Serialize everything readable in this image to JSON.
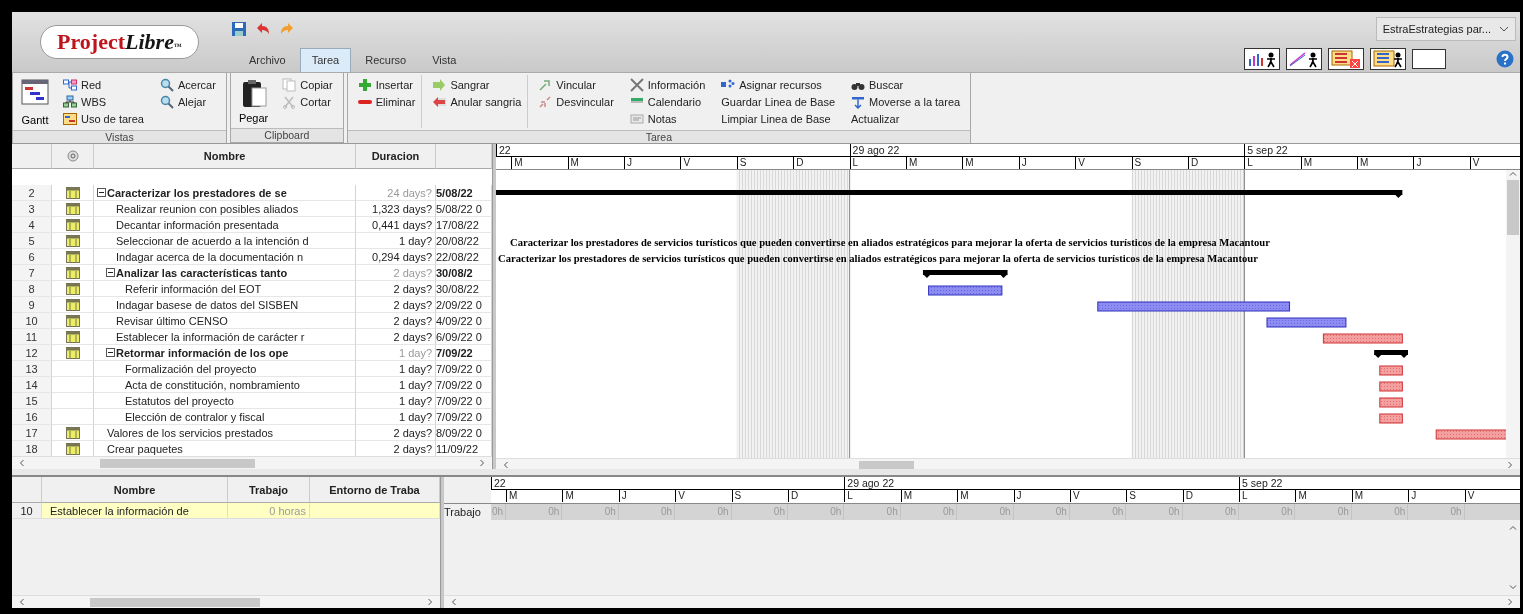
{
  "app": {
    "logo": {
      "first": "Project",
      "second": "Libre",
      "mark": "™"
    },
    "project_dropdown": "EstraEstrategias par..."
  },
  "tabs": [
    {
      "label": "Archivo",
      "selected": false
    },
    {
      "label": "Tarea",
      "selected": true
    },
    {
      "label": "Recurso",
      "selected": false
    },
    {
      "label": "Vista",
      "selected": false
    }
  ],
  "ribbon": {
    "groups": [
      {
        "label": "Vistas",
        "large": "Gantt",
        "columns": [
          [
            "Red",
            "WBS",
            "Uso de tarea"
          ],
          [
            "Acercar",
            "Alejar"
          ]
        ]
      },
      {
        "label": "Clipboard",
        "large": "Pegar",
        "columns": [
          [
            "Copiar",
            "Cortar"
          ]
        ]
      },
      {
        "label": "Tarea",
        "columns": [
          [
            "Insertar",
            "Eliminar"
          ],
          [
            "Sangrar",
            "Anular sangria"
          ],
          [
            "Vincular",
            "Desvincular"
          ],
          [
            "Información",
            "Calendario",
            "Notas"
          ],
          [
            "Asignar recursos",
            "Guardar Linea de Base",
            "Limpiar Linea de Base"
          ],
          [
            "Buscar",
            "Moverse a la tarea",
            "Actualizar"
          ]
        ]
      }
    ]
  },
  "table": {
    "columns": [
      "Nombre",
      "Duracion"
    ],
    "rows": [
      {
        "num": "2",
        "indicator": true,
        "name": "Caracterizar los prestadores de se",
        "duration": "24 days?",
        "start": "5/08/22",
        "expanded": true,
        "children": [
          {
            "num": "3",
            "indicator": true,
            "name": "Realizar reunion con posibles aliados",
            "duration": "1,323 days?",
            "start": "5/08/22 0"
          },
          {
            "num": "4",
            "indicator": true,
            "name": "Decantar información presentada",
            "duration": "0,441 days?",
            "start": "17/08/22"
          },
          {
            "num": "5",
            "indicator": true,
            "name": "Seleccionar de acuerdo a la intención d",
            "duration": "1 day?",
            "start": "20/08/22",
            "gantt_label": "Caracterizar los prestadores de servicios turísticos que pueden convertirse en aliados estratégicos para mejorar la oferta de servicios turísticos de la empresa Macantour"
          },
          {
            "num": "6",
            "indicator": true,
            "name": "Indagar acerca de la documentación n",
            "duration": "0,294 days?",
            "start": "22/08/22",
            "gantt_label": "Caracterizar los prestadores de servicios turísticos que pueden convertirse en aliados estratégicos para mejorar la oferta de servicios turísticos de la empresa Macantour"
          },
          {
            "num": "7",
            "indicator": true,
            "name": "Analizar las características tanto",
            "duration": "2 days?",
            "start": "30/08/2",
            "expanded": true,
            "children": [
              {
                "num": "8",
                "indicator": true,
                "name": "Referir información del EOT",
                "duration": "2 days?",
                "start": "30/08/22",
                "critical": false
              }
            ]
          },
          {
            "num": "9",
            "indicator": true,
            "name": "Indagar basese de datos del SISBEN",
            "duration": "2 days?",
            "start": "2/09/22 0",
            "critical": false
          },
          {
            "num": "10",
            "indicator": true,
            "name": "Revisar último CENSO",
            "duration": "2 days?",
            "start": "4/09/22 0",
            "critical": false
          },
          {
            "num": "11",
            "indicator": true,
            "name": "Establecer la información de carácter r",
            "duration": "2 days?",
            "start": "6/09/22 0",
            "critical": true
          },
          {
            "num": "12",
            "indicator": true,
            "name": "Retormar información de los ope",
            "duration": "1 day?",
            "start": "7/09/22",
            "expanded": true,
            "children": [
              {
                "num": "13",
                "indicator": false,
                "name": "Formalización del proyecto",
                "duration": "1 day?",
                "start": "7/09/22 0",
                "critical": true
              },
              {
                "num": "14",
                "indicator": false,
                "name": "Acta de constitución, nombramiento",
                "duration": "1 day?",
                "start": "7/09/22 0",
                "critical": true
              },
              {
                "num": "15",
                "indicator": false,
                "name": "Estatutos del proyecto",
                "duration": "1 day?",
                "start": "7/09/22 0",
                "critical": true
              },
              {
                "num": "16",
                "indicator": false,
                "name": "Elección de contralor y fiscal",
                "duration": "1 day?",
                "start": "7/09/22 0",
                "critical": true
              }
            ]
          }
        ]
      },
      {
        "num": "17",
        "indicator": true,
        "name": "Valores de los servicios prestados",
        "duration": "2 days?",
        "start": "8/09/22 0",
        "critical": true
      },
      {
        "num": "18",
        "indicator": true,
        "name": "Crear paquetes",
        "duration": "2 days?",
        "start": "11/09/22"
      }
    ]
  },
  "gantt": {
    "timescale": {
      "weeks": [
        {
          "label": "22",
          "days": [
            "M",
            "M",
            "J",
            "V",
            "S",
            "D"
          ]
        },
        {
          "label": "29 ago 22",
          "days": [
            "L",
            "M",
            "M",
            "J",
            "V",
            "S",
            "D"
          ]
        },
        {
          "label": "5 sep 22",
          "days": [
            "L",
            "M",
            "M",
            "J",
            "V"
          ]
        }
      ]
    }
  },
  "usage": {
    "table": {
      "columns": [
        "Nombre",
        "Trabajo",
        "Entorno de Traba"
      ],
      "rows": [
        {
          "num": "10",
          "name": "Establecer la información de",
          "work": "0 horas"
        }
      ]
    },
    "timeline": {
      "row_label": "Trabajo",
      "timescale": {
        "weeks": [
          {
            "label": "22",
            "days": [
              "M",
              "M",
              "J",
              "V",
              "S",
              "D"
            ]
          },
          {
            "label": "29 ago 22",
            "days": [
              "L",
              "M",
              "M",
              "J",
              "V",
              "S",
              "D"
            ]
          },
          {
            "label": "5 sep 22",
            "days": [
              "L",
              "M",
              "M",
              "J",
              "V"
            ]
          }
        ]
      },
      "values": [
        "0h",
        "0h",
        "0h",
        "0h",
        "0h",
        "0h",
        "0h",
        "0h",
        "0h",
        "0h",
        "0h",
        "0h",
        "0h",
        "0h",
        "0h",
        "0h",
        "0h",
        "0h"
      ]
    }
  }
}
